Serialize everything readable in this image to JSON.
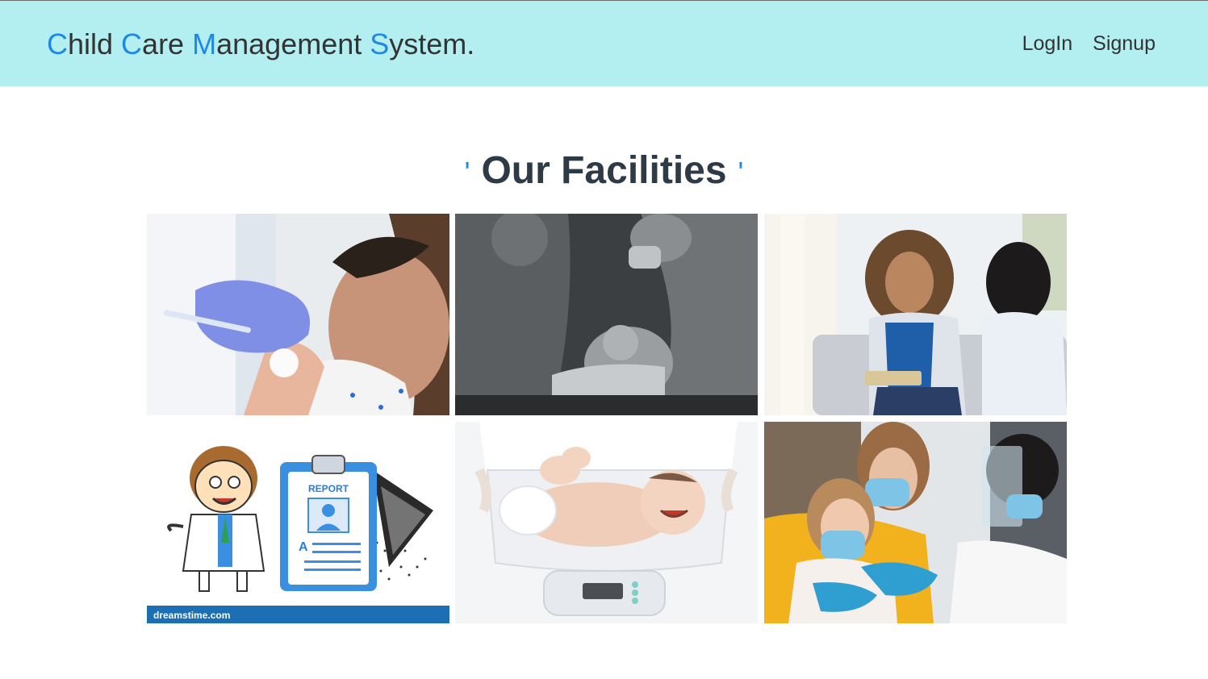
{
  "header": {
    "brand": {
      "parts": [
        {
          "initial": "C",
          "rest": "hild "
        },
        {
          "initial": "C",
          "rest": "are "
        },
        {
          "initial": "M",
          "rest": "anagement "
        },
        {
          "initial": "S",
          "rest": "ystem."
        }
      ]
    },
    "nav": {
      "login_label": "LogIn",
      "signup_label": "Signup"
    }
  },
  "facilities": {
    "title": "Our Facilities",
    "quote_mark": "'",
    "images": [
      {
        "icon": "child-vaccination-photo"
      },
      {
        "icon": "newborn-delivery-photo"
      },
      {
        "icon": "counselling-session-photo"
      },
      {
        "icon": "doctor-report-illustration",
        "watermark": "dreamstime.com",
        "report_label": "REPORT",
        "grade": "A"
      },
      {
        "icon": "baby-weighing-scale-photo"
      },
      {
        "icon": "masked-child-vaccination-photo"
      }
    ]
  },
  "colors": {
    "navbar_bg": "#b3eff1",
    "accent": "#1e88e5",
    "title_text": "#2e3a45"
  }
}
